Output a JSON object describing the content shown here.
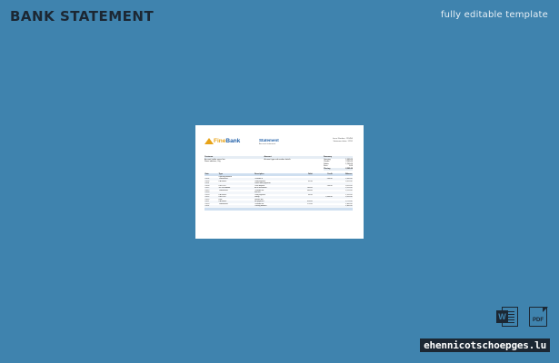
{
  "page": {
    "title": "BANK STATEMENT",
    "subtitle": "fully editable template",
    "site": "ehennicotschoepges.lu",
    "colors": {
      "background": "#3f83ae",
      "title": "#1c2733",
      "brand_blue": "#1f5fa8",
      "brand_gold": "#e8a317"
    }
  },
  "document": {
    "logo": {
      "part1": "Fine",
      "part2": "Bank"
    },
    "heading": "Statement",
    "heading_sub": "Account statement",
    "meta": [
      "Issue Number: 123456",
      "Statement date: 12/31"
    ],
    "info": {
      "col1_header": "Customer",
      "col1_lines": [
        "Account holder name line",
        "Street address, City"
      ],
      "col2_header": "Account",
      "col2_lines": [
        "Account type and number details"
      ],
      "col3_header": "Summary",
      "summary": [
        {
          "label": "Opening",
          "value": "1,000.00"
        },
        {
          "label": "Credits",
          "value": "2,500.00"
        },
        {
          "label": "Debits",
          "value": "1,200.00"
        },
        {
          "label": "Fees",
          "value": "0.00"
        },
        {
          "label": "Closing",
          "value": "2,300.00"
        }
      ]
    },
    "table": {
      "headers": [
        "Date",
        "Type",
        "Description",
        "Debit",
        "Credit",
        "Balance"
      ],
      "rows": [
        [
          "",
          "Opening balance",
          "",
          "",
          "",
          ""
        ],
        [
          "01/02",
          "TRANSFER",
          "Transfer in",
          "",
          "500.00",
          "1,500.00"
        ],
        [
          "01/05",
          "PAYMENT",
          "Card payment",
          "45.00",
          "",
          "1,455.00"
        ],
        [
          "01/07",
          "",
          "Direct debit payment",
          "",
          "",
          ""
        ],
        [
          "01/09",
          "DEPOSIT",
          "Cash deposit",
          "",
          "200.00",
          "1,655.00"
        ],
        [
          "01/12",
          "WITHDRAWAL",
          "ATM withdrawal",
          "100.00",
          "",
          "1,555.00"
        ],
        [
          "01/15",
          "TRANSFER",
          "Transfer out",
          "300.00",
          "",
          "1,255.00"
        ],
        [
          "01/18",
          "",
          "Interest",
          "",
          "",
          ""
        ],
        [
          "01/20",
          "PAYMENT",
          "Card payment",
          "60.00",
          "",
          "1,195.00"
        ],
        [
          "01/22",
          "DEPOSIT",
          "Salary",
          "",
          "1,800.00",
          "2,995.00"
        ],
        [
          "01/25",
          "FEE",
          "Service fee",
          "",
          "",
          ""
        ],
        [
          "01/27",
          "PAYMENT",
          "Bill payment",
          "420.00",
          "",
          "2,575.00"
        ],
        [
          "01/29",
          "TRANSFER",
          "Transfer out",
          "275.00",
          "",
          "2,300.00"
        ],
        [
          "01/31",
          "",
          "Closing balance",
          "",
          "",
          "2,300.00"
        ]
      ]
    }
  }
}
